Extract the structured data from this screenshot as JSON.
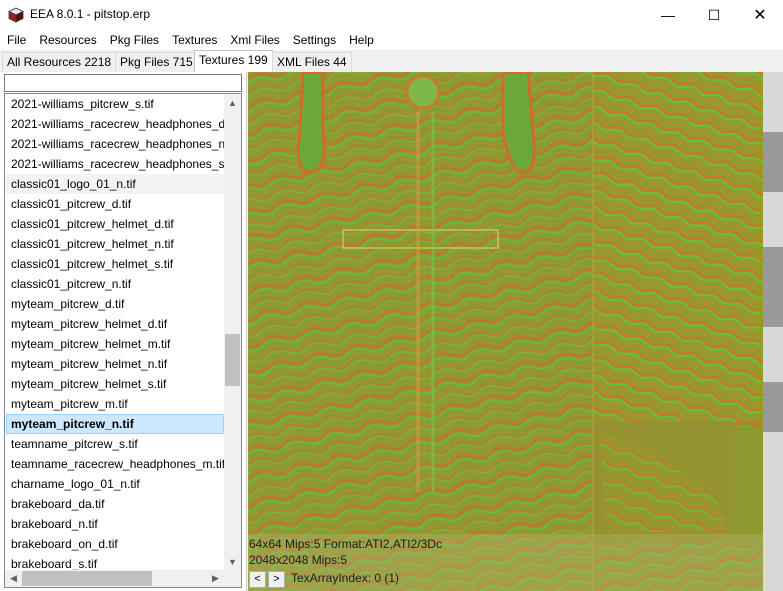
{
  "window": {
    "title": "EEA 8.0.1 - pitstop.erp",
    "minimize_glyph": "—",
    "maximize_glyph": "☐",
    "close_glyph": "✕"
  },
  "menu": [
    "File",
    "Resources",
    "Pkg Files",
    "Textures",
    "Xml Files",
    "Settings",
    "Help"
  ],
  "tabs": [
    {
      "label": "All Resources 2218"
    },
    {
      "label": "Pkg Files 715"
    },
    {
      "label": "Textures 199"
    },
    {
      "label": "XML Files 44"
    }
  ],
  "search": {
    "value": ""
  },
  "file_list": [
    "2021-williams_pitcrew_s.tif",
    "2021-williams_racecrew_headphones_d.tif",
    "2021-williams_racecrew_headphones_n.tif",
    "2021-williams_racecrew_headphones_s.tif",
    "classic01_logo_01_n.tif",
    "classic01_pitcrew_d.tif",
    "classic01_pitcrew_helmet_d.tif",
    "classic01_pitcrew_helmet_n.tif",
    "classic01_pitcrew_helmet_s.tif",
    "classic01_pitcrew_n.tif",
    "myteam_pitcrew_d.tif",
    "myteam_pitcrew_helmet_d.tif",
    "myteam_pitcrew_helmet_m.tif",
    "myteam_pitcrew_helmet_n.tif",
    "myteam_pitcrew_helmet_s.tif",
    "myteam_pitcrew_m.tif",
    "myteam_pitcrew_n.tif",
    "teamname_pitcrew_s.tif",
    "teamname_racecrew_headphones_m.tif",
    "charname_logo_01_n.tif",
    "brakeboard_da.tif",
    "brakeboard_n.tif",
    "brakeboard_on_d.tif",
    "brakeboard_s.tif"
  ],
  "selected_file": "myteam_pitcrew_n.tif",
  "preview": {
    "info_line1": "64x64 Mips:5 Format:ATI2,ATI2/3Dc",
    "info_line2": "2048x2048 Mips:5",
    "prev_label": "<",
    "next_label": ">",
    "tex_array_index": "TexArrayIndex: 0 (1)"
  },
  "colors": {
    "selection_bg": "#cce8ff",
    "selection_border": "#99d1ff",
    "normal_map_base": "#8f9a2e",
    "normal_map_red": "#e0702a",
    "normal_map_green": "#4ec94a"
  }
}
